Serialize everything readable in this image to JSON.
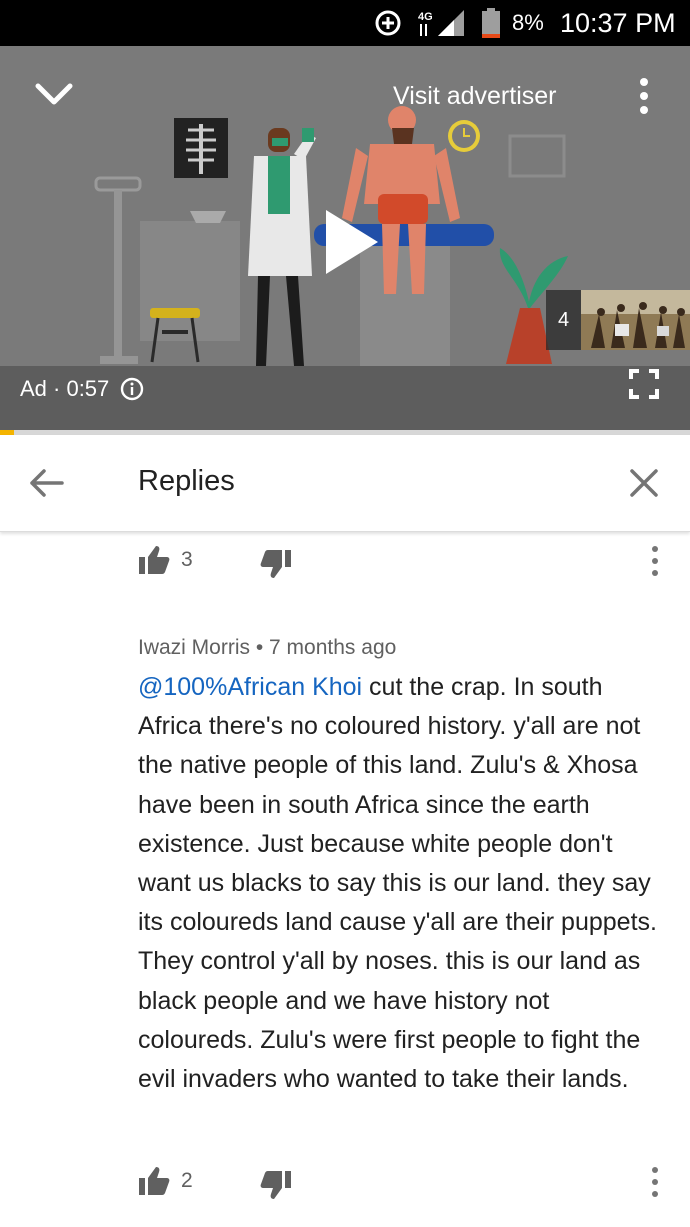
{
  "status_bar": {
    "network": "4G",
    "battery": "8%",
    "time": "10:37 PM"
  },
  "player": {
    "visit_advertiser": "Visit advertiser",
    "queue_count": "4",
    "ad_label": "Ad · 0:57",
    "progress_fraction": 0.02,
    "progress_color": "#f4b400"
  },
  "header": {
    "title": "Replies"
  },
  "comments": [
    {
      "likes": "3"
    },
    {
      "author": "Iwazi Morris",
      "time_ago": "7 months ago",
      "mention": "@100%African Khoi",
      "text": " cut the crap. In south Africa there's no coloured history. y'all are not the native people of this land. Zulu's & Xhosa have been in south Africa since the earth existence. Just because white people don't want us blacks to say this is our land. they say its coloureds land cause y'all are their puppets. They control y'all by noses. this is our land as black people and we have history not coloureds. Zulu's were first people to fight the evil invaders who wanted to take their lands.",
      "likes": "2"
    }
  ],
  "colors": {
    "mention": "#1565c0",
    "text": "#212121",
    "secondary": "#606060"
  }
}
